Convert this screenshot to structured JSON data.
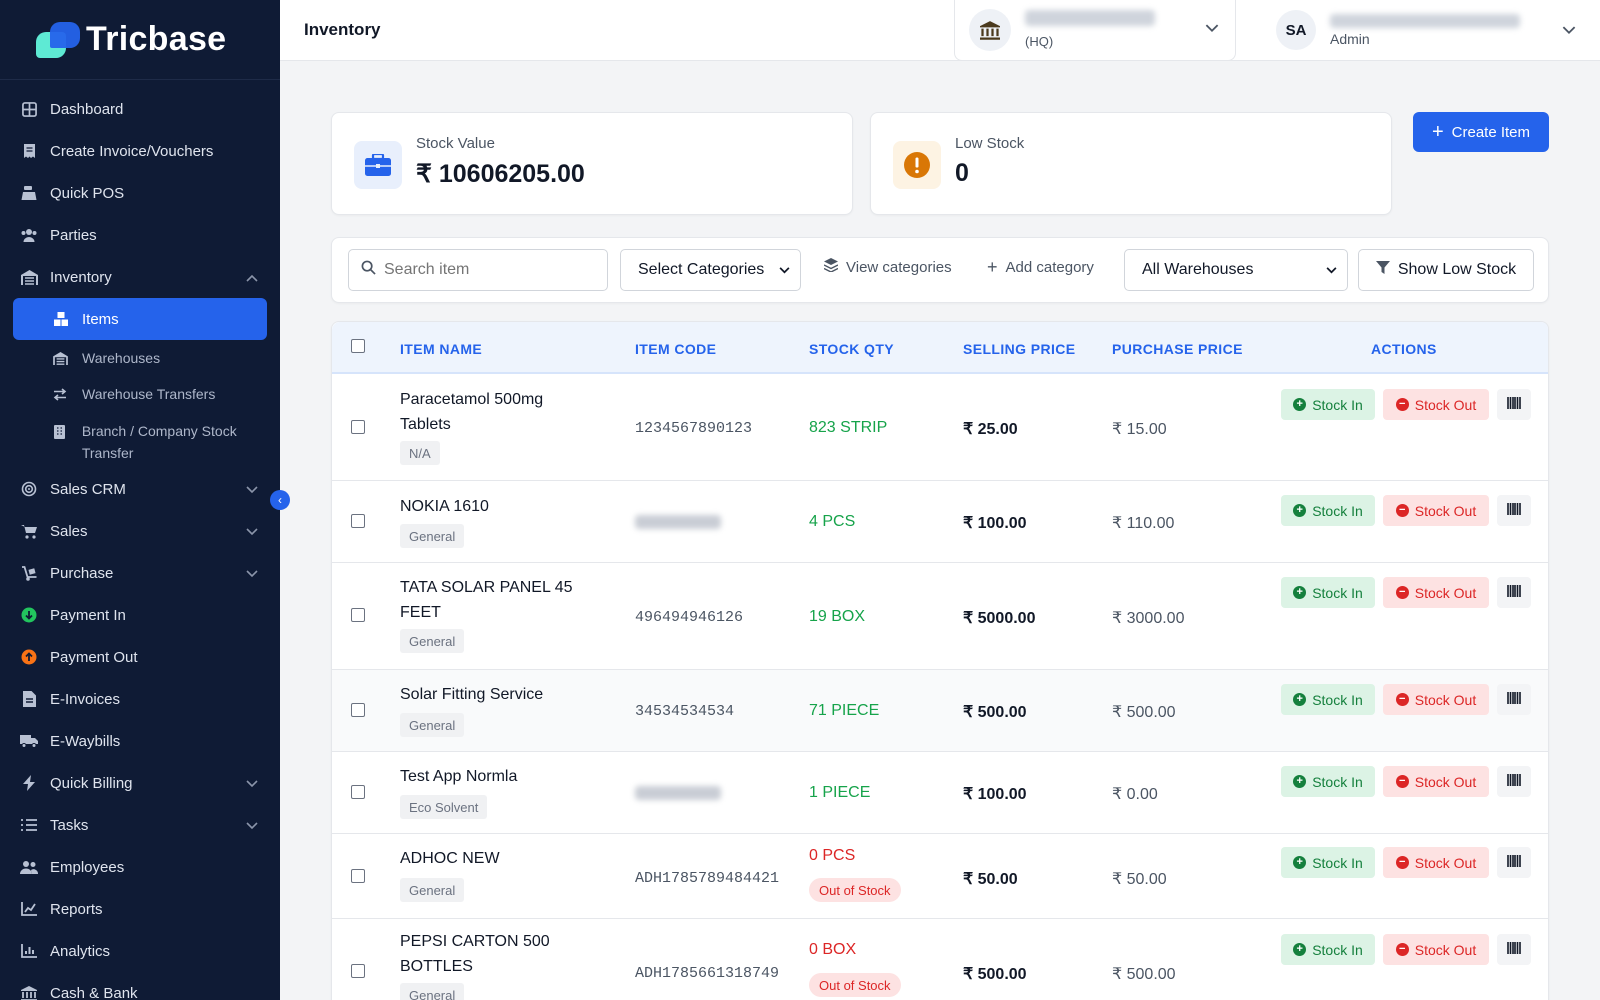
{
  "brand": {
    "name": "Tricbase"
  },
  "sidebar": {
    "items": [
      {
        "label": "Dashboard",
        "icon": "grid-icon"
      },
      {
        "label": "Create Invoice/Vouchers",
        "icon": "receipt-icon"
      },
      {
        "label": "Quick POS",
        "icon": "register-icon"
      },
      {
        "label": "Parties",
        "icon": "users-icon"
      },
      {
        "label": "Inventory",
        "icon": "warehouse-icon"
      },
      {
        "label": "Items",
        "icon": "boxes-icon"
      },
      {
        "label": "Warehouses",
        "icon": "warehouse-icon"
      },
      {
        "label": "Warehouse Transfers",
        "icon": "transfer-icon"
      },
      {
        "label": "Branch / Company Stock Transfer",
        "icon": "building-icon"
      },
      {
        "label": "Sales CRM",
        "icon": "target-icon"
      },
      {
        "label": "Sales",
        "icon": "cart-icon"
      },
      {
        "label": "Purchase",
        "icon": "dolly-icon"
      },
      {
        "label": "Payment In",
        "icon": "payment-in-icon"
      },
      {
        "label": "Payment Out",
        "icon": "payment-out-icon"
      },
      {
        "label": "E-Invoices",
        "icon": "file-invoice-icon"
      },
      {
        "label": "E-Waybills",
        "icon": "truck-icon"
      },
      {
        "label": "Quick Billing",
        "icon": "bolt-icon"
      },
      {
        "label": "Tasks",
        "icon": "tasks-icon"
      },
      {
        "label": "Employees",
        "icon": "users-icon"
      },
      {
        "label": "Reports",
        "icon": "chart-line-icon"
      },
      {
        "label": "Analytics",
        "icon": "chart-bar-icon"
      },
      {
        "label": "Cash & Bank",
        "icon": "bank-icon"
      }
    ]
  },
  "header": {
    "title": "Inventory",
    "branch_sub": "(HQ)",
    "user_initials": "SA",
    "user_role": "Admin"
  },
  "stats": {
    "stock_value_label": "Stock Value",
    "stock_value": "₹ 10606205.00",
    "low_stock_label": "Low Stock",
    "low_stock": "0"
  },
  "actions": {
    "create_item": "Create Item"
  },
  "filters": {
    "search_placeholder": "Search item",
    "categories_select": "Select Categories",
    "view_categories": "View categories",
    "add_category": "Add category",
    "warehouses_select": "All Warehouses",
    "show_low_stock": "Show Low Stock"
  },
  "table": {
    "columns": [
      "ITEM NAME",
      "ITEM CODE",
      "STOCK QTY",
      "SELLING PRICE",
      "PURCHASE PRICE",
      "ACTIONS"
    ],
    "stock_in_label": "Stock In",
    "stock_out_label": "Stock Out",
    "out_of_stock_label": "Out of Stock",
    "rows": [
      {
        "name": "Paracetamol 500mg Tablets",
        "category": "N/A",
        "code": "1234567890123",
        "qty": "823 STRIP",
        "selling": "₹ 25.00",
        "purchase": "₹ 15.00"
      },
      {
        "name": "NOKIA 1610",
        "category": "General",
        "code": "",
        "qty": "4 PCS",
        "selling": "₹ 100.00",
        "purchase": "₹ 110.00"
      },
      {
        "name": "TATA SOLAR PANEL 45 FEET",
        "category": "General",
        "code": "496494946126",
        "qty": "19 BOX",
        "selling": "₹ 5000.00",
        "purchase": "₹ 3000.00"
      },
      {
        "name": "Solar Fitting Service",
        "category": "General",
        "code": "34534534534",
        "qty": "71 PIECE",
        "selling": "₹ 500.00",
        "purchase": "₹ 500.00"
      },
      {
        "name": "Test App Normla",
        "category": "Eco Solvent",
        "code": "",
        "qty": "1 PIECE",
        "selling": "₹ 100.00",
        "purchase": "₹ 0.00"
      },
      {
        "name": "ADHOC NEW",
        "category": "General",
        "code": "ADH1785789484421",
        "qty": "0 PCS",
        "selling": "₹ 50.00",
        "purchase": "₹ 50.00"
      },
      {
        "name": "PEPSI CARTON 500 BOTTLES",
        "category": "General",
        "code": "ADH1785661318749",
        "qty": "0 BOX",
        "selling": "₹ 500.00",
        "purchase": "₹ 500.00"
      }
    ]
  }
}
